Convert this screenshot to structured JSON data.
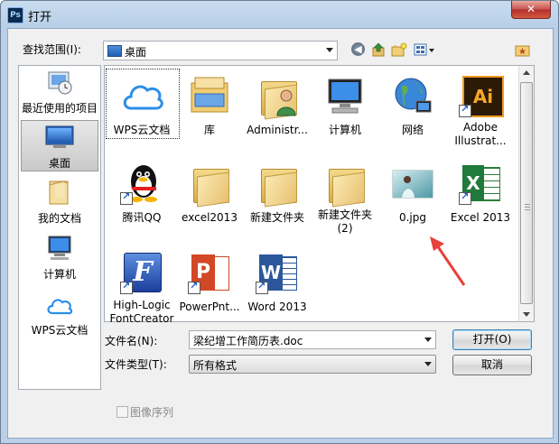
{
  "window": {
    "title": "打开",
    "app_icon_text": "Ps",
    "close_symbol": "✕"
  },
  "lookin": {
    "label": "查找范围(I):",
    "value": "桌面"
  },
  "places": [
    {
      "label": "最近使用的项目",
      "icon": "recent-items-icon"
    },
    {
      "label": "桌面",
      "icon": "desktop-icon",
      "selected": true
    },
    {
      "label": "我的文档",
      "icon": "documents-folder-icon"
    },
    {
      "label": "计算机",
      "icon": "computer-icon"
    },
    {
      "label": "WPS云文档",
      "icon": "wps-cloud-icon"
    }
  ],
  "files": [
    {
      "label": "WPS云文档",
      "icon": "wps-cloud-icon"
    },
    {
      "label": "库",
      "icon": "library-folder-icon"
    },
    {
      "label": "Administr...",
      "icon": "user-folder-icon"
    },
    {
      "label": "计算机",
      "icon": "computer-icon"
    },
    {
      "label": "网络",
      "icon": "network-globe-icon"
    },
    {
      "label": "Adobe Illustrat...",
      "icon": "adobe-illustrator-icon",
      "icon_text": "Ai"
    },
    {
      "label": "腾讯QQ",
      "icon": "qq-penguin-icon"
    },
    {
      "label": "excel2013",
      "icon": "folder-icon"
    },
    {
      "label": "新建文件夹",
      "icon": "folder-icon"
    },
    {
      "label": "新建文件夹 (2)",
      "icon": "folder-icon"
    },
    {
      "label": "0.jpg",
      "icon": "image-thumbnail-icon"
    },
    {
      "label": "Excel 2013",
      "icon": "excel-icon",
      "icon_text": "X"
    },
    {
      "label": "High-Logic FontCreator",
      "icon": "fontcreator-icon",
      "icon_text": "F"
    },
    {
      "label": "PowerPnt...",
      "icon": "powerpoint-icon",
      "icon_text": "P"
    },
    {
      "label": "Word 2013",
      "icon": "word-icon",
      "icon_text": "W"
    }
  ],
  "filename": {
    "label": "文件名(N):",
    "value": "梁纪增工作简历表.doc"
  },
  "filetype": {
    "label": "文件类型(T):",
    "value": "所有格式"
  },
  "buttons": {
    "open": "打开(O)",
    "cancel": "取消"
  },
  "image_sequence": {
    "label": "图像序列"
  },
  "colors": {
    "accent": "#1a5ab8",
    "annotation_arrow": "#e8403a",
    "titlebar": "#c9dcef"
  }
}
